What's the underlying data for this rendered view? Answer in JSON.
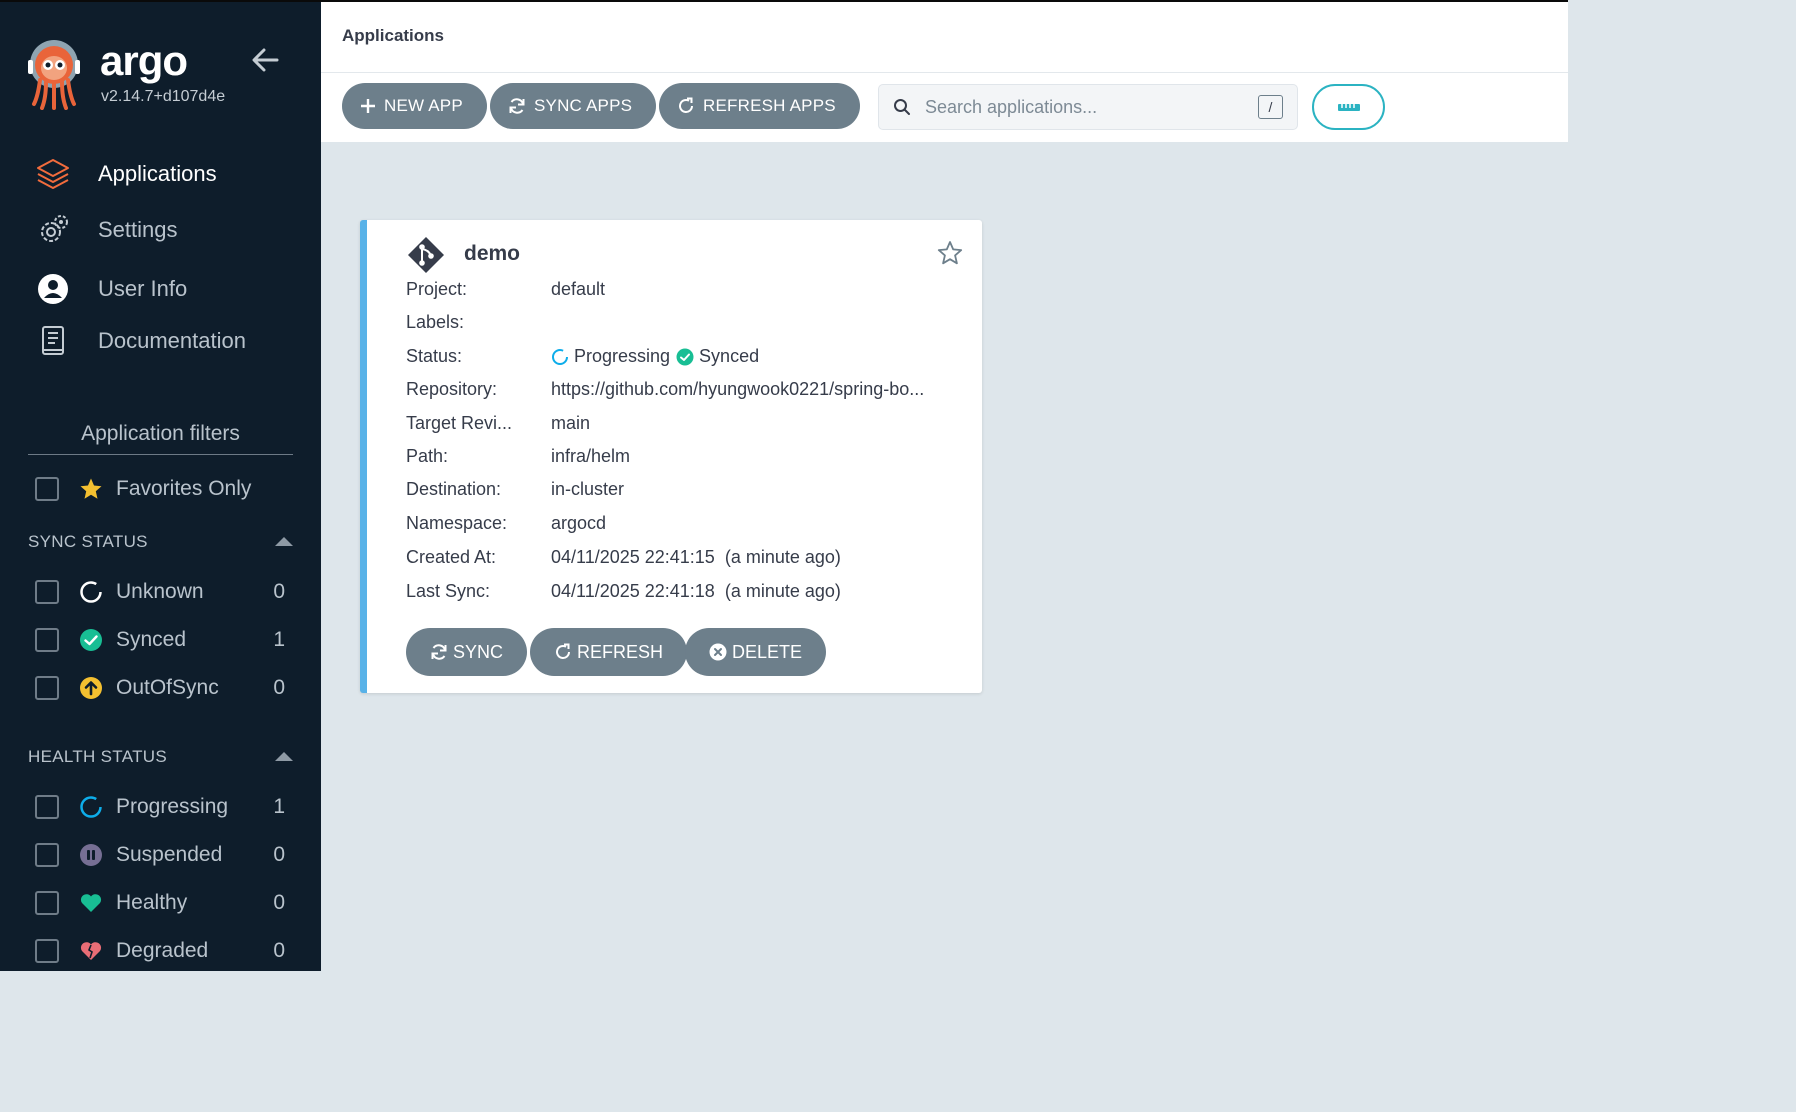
{
  "sidebar": {
    "brand": "argo",
    "version": "v2.14.7+d107d4e",
    "nav": [
      {
        "label": "Applications",
        "icon": "layers-icon",
        "active": true
      },
      {
        "label": "Settings",
        "icon": "gear-icon"
      },
      {
        "label": "User Info",
        "icon": "user-icon"
      },
      {
        "label": "Documentation",
        "icon": "book-icon"
      }
    ],
    "filters_title": "Application filters",
    "favorites_label": "Favorites Only",
    "sync_status": {
      "title": "SYNC STATUS",
      "items": [
        {
          "label": "Unknown",
          "count": "0",
          "color": "#ffffff"
        },
        {
          "label": "Synced",
          "count": "1",
          "color": "#18be94"
        },
        {
          "label": "OutOfSync",
          "count": "0",
          "color": "#f4c030"
        }
      ]
    },
    "health_status": {
      "title": "HEALTH STATUS",
      "items": [
        {
          "label": "Progressing",
          "count": "1",
          "color": "#0dadea"
        },
        {
          "label": "Suspended",
          "count": "0",
          "color": "#766f94"
        },
        {
          "label": "Healthy",
          "count": "0",
          "color": "#18be94"
        },
        {
          "label": "Degraded",
          "count": "0",
          "color": "#e96d76"
        }
      ]
    }
  },
  "topbar": {
    "title": "Applications",
    "new_app": "NEW APP",
    "sync_apps": "SYNC APPS",
    "refresh_apps": "REFRESH APPS",
    "search_placeholder": "Search applications...",
    "search_shortcut": "/"
  },
  "app": {
    "name": "demo",
    "fields": [
      {
        "key": "Project:",
        "value": "default"
      },
      {
        "key": "Labels:",
        "value": ""
      },
      {
        "key": "Status:",
        "value": ""
      },
      {
        "key": "Repository:",
        "value": "https://github.com/hyungwook0221/spring-bo..."
      },
      {
        "key": "Target Revi...",
        "value": "main"
      },
      {
        "key": "Path:",
        "value": "infra/helm"
      },
      {
        "key": "Destination:",
        "value": "in-cluster"
      },
      {
        "key": "Namespace:",
        "value": "argocd"
      },
      {
        "key": "Created At:",
        "value": "04/11/2025 22:41:15  (a minute ago)"
      },
      {
        "key": "Last Sync:",
        "value": "04/11/2025 22:41:18  (a minute ago)"
      }
    ],
    "health": "Progressing",
    "sync": "Synced",
    "buttons": {
      "sync": "SYNC",
      "refresh": "REFRESH",
      "delete": "DELETE"
    }
  },
  "colors": {
    "sidebar_bg": "#0e1d2b",
    "accent": "#f26c3d",
    "button_bg": "#6d7f8b",
    "card_border": "#58b2e8",
    "teal": "#2bb3c2"
  }
}
